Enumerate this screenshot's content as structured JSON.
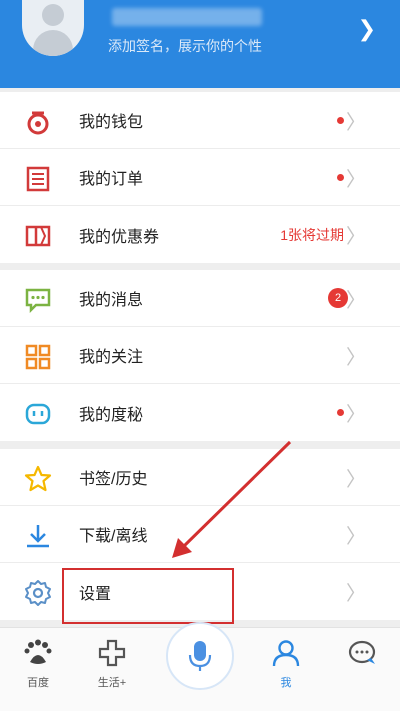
{
  "header": {
    "signature": "添加签名，展示你的个性"
  },
  "menu": {
    "group1": [
      {
        "label": "我的钱包",
        "icon": "wallet-icon",
        "indicator": "dot"
      },
      {
        "label": "我的订单",
        "icon": "order-list-icon",
        "indicator": "dot"
      },
      {
        "label": "我的优惠券",
        "icon": "coupon-icon",
        "note": "1张将过期"
      }
    ],
    "group2": [
      {
        "label": "我的消息",
        "icon": "message-icon",
        "badge": "2"
      },
      {
        "label": "我的关注",
        "icon": "grid-icon"
      },
      {
        "label": "我的度秘",
        "icon": "robot-face-icon",
        "indicator": "dot"
      }
    ],
    "group3": [
      {
        "label": "书签/历史",
        "icon": "star-icon"
      },
      {
        "label": "下载/离线",
        "icon": "download-icon"
      },
      {
        "label": "设置",
        "icon": "gear-icon"
      }
    ]
  },
  "tabbar": {
    "tabs": [
      {
        "label": "百度",
        "icon": "baidu-paw-icon"
      },
      {
        "label": "生活+",
        "icon": "cross-life-icon"
      },
      {
        "label": "",
        "icon": "microphone-icon"
      },
      {
        "label": "我",
        "icon": "person-icon"
      },
      {
        "label": "",
        "icon": "chat-bubble-icon"
      }
    ]
  },
  "colors": {
    "header_bg": "#2b87e0",
    "accent_red": "#e53935",
    "icon_red": "#d23a3a",
    "icon_green": "#7cb342",
    "icon_orange": "#f08a24",
    "icon_blue": "#2b87e0",
    "icon_yellow": "#f5b800",
    "annotation_red": "#d32f2f"
  }
}
